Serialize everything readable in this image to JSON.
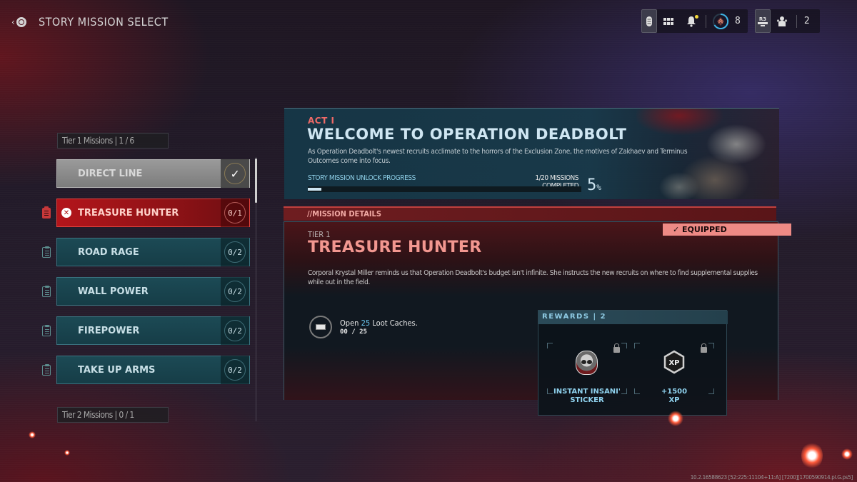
{
  "header": {
    "back_icon": "back-chevron-icon",
    "title": "STORY MISSION SELECT"
  },
  "topbar": {
    "icons": [
      "controller-icon",
      "grid-menu-icon",
      "notification-bell-icon",
      "rank-badge-icon",
      "r3-button-icon",
      "party-icon"
    ],
    "notification_dot_color": "#f4d83a",
    "rank_value": "8",
    "r3_label": "R3",
    "party_count": "2"
  },
  "mission_list": {
    "tier1_label": "Tier 1 Missions | 1 / 6",
    "tier2_label": "Tier 2 Missions | 0 / 1",
    "items": [
      {
        "name": "DIRECT LINE",
        "state": "completed",
        "progress": "✓"
      },
      {
        "name": "TREASURE HUNTER",
        "state": "active",
        "progress": "0/1"
      },
      {
        "name": "ROAD RAGE",
        "state": "locked",
        "progress": "0/2"
      },
      {
        "name": "WALL POWER",
        "state": "locked",
        "progress": "0/2"
      },
      {
        "name": "FIREPOWER",
        "state": "locked",
        "progress": "0/2"
      },
      {
        "name": "TAKE UP ARMS",
        "state": "locked",
        "progress": "0/2"
      }
    ]
  },
  "act": {
    "label": "ACT I",
    "title": "WELCOME TO OPERATION DEADBOLT",
    "description": "As Operation Deadbolt's newest recruits acclimate to the horrors of the Exclusion Zone, the motives of Zakhaev and Terminus Outcomes come into focus.",
    "progress_label": "STORY MISSION UNLOCK PROGRESS",
    "progress_count": "1/20 MISSIONS COMPLETED",
    "progress_percent_value": "5",
    "progress_percent_unit": "%",
    "progress_fraction": 0.05
  },
  "details": {
    "section_label": "//MISSION DETAILS",
    "equipped_label": "✓ EQUIPPED",
    "tier": "TIER 1",
    "title": "TREASURE HUNTER",
    "description": "Corporal Krystal Miller reminds us that Operation Deadbolt's budget isn't infinite. She instructs the new recruits on where to find supplemental supplies while out in the field.",
    "objective": {
      "prefix": "Open ",
      "highlight": "25",
      "suffix": " Loot Caches.",
      "progress": "00 / 25",
      "icon": "loot-cache-icon"
    },
    "rewards": {
      "header": "REWARDS | 2",
      "items": [
        {
          "name_line1": "INSTANT INSANI'",
          "name_line2": "STICKER",
          "icon": "skull-sticker-icon",
          "locked": true
        },
        {
          "name_line1": "+1500",
          "name_line2": "XP",
          "icon": "xp-icon",
          "locked": true
        }
      ]
    }
  },
  "footer": {
    "build_string": "10.2.16588623 [52:225:11104+11:A] [7200][1700590914.pl.G.ps5]"
  },
  "colors": {
    "accent_red": "#b3151b",
    "accent_teal": "#1c4a55",
    "title_blue": "#cfe6f2",
    "title_red": "#f29790",
    "highlight_blue": "#69c3ea"
  }
}
